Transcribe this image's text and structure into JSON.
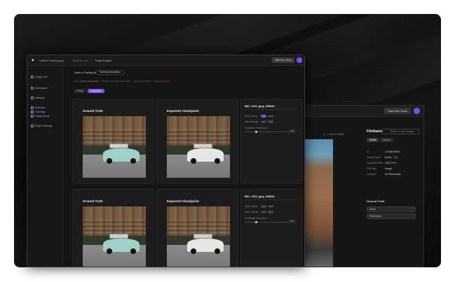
{
  "colors": {
    "accent": "#7c4dff",
    "success": "#6ac46a",
    "danger": "#e5484d"
  },
  "back_window": {
    "run_label": "Start Run Once",
    "count": "1 - 1 out of 1000",
    "panel_title": "FileName",
    "search_placeholder": "Search in new images",
    "tabs": [
      "Detail",
      "History"
    ],
    "rows": [
      {
        "k": "ID",
        "v": "1234WHOS6"
      },
      {
        "k": "Frame Scale",
        "v": "Books · Try"
      },
      {
        "k": "Uploaded Date",
        "v": "2023 Fri 9"
      },
      {
        "k": "File Type",
        "v": "Image"
      },
      {
        "k": "Location",
        "v": "US Streetcabs"
      }
    ],
    "ground_truth": "Ground Truth",
    "selects": [
      "Stairs",
      "Pedestrian"
    ]
  },
  "topbar": {
    "workspace": "HARVO Workspace",
    "crumb_project": "Projects List",
    "crumb_current": "Truck Project",
    "run_label": "Start Run Once"
  },
  "sidebar": {
    "items": [
      {
        "label": "Image 0.A1",
        "icon": "image-icon"
      },
      {
        "label": "Workspace",
        "icon": "workspace-icon"
      },
      {
        "label": "Datasets",
        "icon": "dataset-icon"
      },
      {
        "label": "Workflow",
        "icon": "workflow-icon"
      },
      {
        "label": "Trainings",
        "icon": "training-icon"
      },
      {
        "label": "Deployments",
        "icon": "deploy-icon"
      },
      {
        "label": "Project Settings",
        "icon": "gear-icon"
      }
    ]
  },
  "main": {
    "back_label": "‹ Back to Training list",
    "pill_label": "Training Information",
    "meta": {
      "status_label": "Status",
      "status_value": "Training Succeeded",
      "run_label": "Training Time",
      "run_value": "2023-08-24 10:11",
      "epoch_label": "Training Acc",
      "epoch_value": "85.8%",
      "device_label": "Devices",
      "device_value": "Running"
    },
    "segments": [
      "Graph",
      "Evaluation"
    ],
    "cards": [
      {
        "gt": "Ground Truth",
        "ck": "Expected Checkpoint"
      },
      {
        "gt": "Ground Truth",
        "ck": "Expected Checkpoint"
      }
    ],
    "info": [
      {
        "file": "IMG_1234_jpeg_049844",
        "show_labels": "Show Labels",
        "label_toggle": "Label",
        "label_display": "Label Display",
        "display_value": "Label",
        "threshold": "Probability Threshold: 0",
        "val": "50"
      },
      {
        "file": "IMG_1233_jpeg_049844",
        "show_labels": "Show Labels",
        "label_toggle": "Label",
        "label_display": "Label Display",
        "display_value": "Label",
        "threshold": "Probability Threshold: 0",
        "val": "50"
      }
    ]
  }
}
